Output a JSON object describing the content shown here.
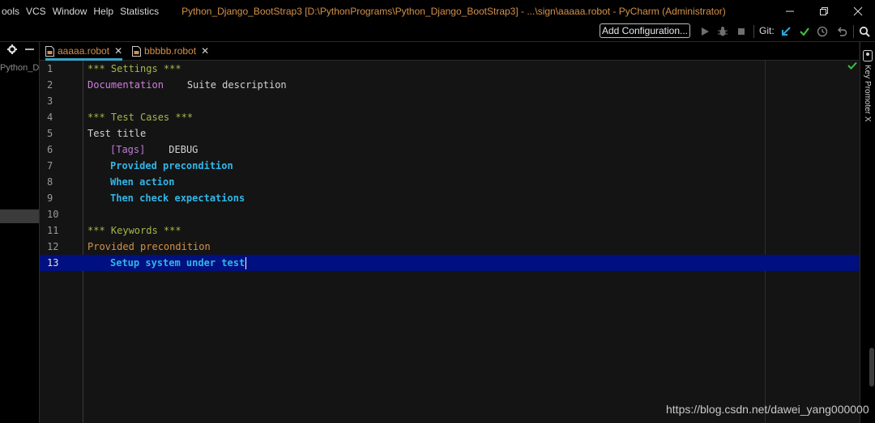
{
  "menu": {
    "items": [
      "ools",
      "VCS",
      "Window",
      "Help",
      "Statistics"
    ],
    "window_title": "Python_Django_BootStrap3 [D:\\PythonPrograms\\Python_Django_BootStrap3] - ...\\sign\\aaaaa.robot - PyCharm (Administrator)"
  },
  "toolbar": {
    "add_configuration_label": "Add Configuration...",
    "git_label": "Git:"
  },
  "project": {
    "root_label": "Python_Dja"
  },
  "tabs": [
    {
      "label": "aaaaa.robot",
      "active": true
    },
    {
      "label": "bbbbb.robot",
      "active": false
    }
  ],
  "editor": {
    "current_line": 13,
    "lines": [
      {
        "num": "1",
        "text": "*** Settings ***"
      },
      {
        "num": "2",
        "key": "Documentation",
        "value": "Suite description"
      },
      {
        "num": "3",
        "text": ""
      },
      {
        "num": "4",
        "text": "*** Test Cases ***"
      },
      {
        "num": "5",
        "text": "Test title"
      },
      {
        "num": "6",
        "tag": "[Tags]",
        "value": "DEBUG"
      },
      {
        "num": "7",
        "text": "Provided precondition"
      },
      {
        "num": "8",
        "text": "When action"
      },
      {
        "num": "9",
        "text": "Then check expectations"
      },
      {
        "num": "10",
        "text": ""
      },
      {
        "num": "11",
        "text": "*** Keywords ***"
      },
      {
        "num": "12",
        "text": "Provided precondition"
      },
      {
        "num": "13",
        "text": "Setup system under test"
      }
    ]
  },
  "right_strip": {
    "label": "Key Promoter X"
  },
  "watermark": "https://blog.csdn.net/dawei_yang000000",
  "colors": {
    "accent_tab": "#39a6c9",
    "title_orange": "#d5914a",
    "current_line_bg": "#001080",
    "section_header": "#a6b64a",
    "keyword_call": "#31b6e8",
    "git_check": "#3fbf3f",
    "git_update": "#2fa8d8"
  }
}
